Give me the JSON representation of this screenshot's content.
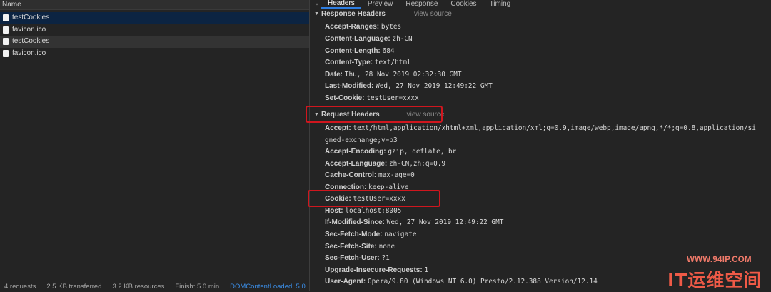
{
  "left_panel": {
    "column_header": "Name",
    "requests": [
      {
        "name": "testCookies"
      },
      {
        "name": "favicon.ico"
      },
      {
        "name": "testCookies"
      },
      {
        "name": "favicon.ico"
      }
    ],
    "status": {
      "requests": "4 requests",
      "transferred": "2.5 KB transferred",
      "resources": "3.2 KB resources",
      "finish": "Finish: 5.0 min",
      "dom_content_loaded": "DOMContentLoaded: 5.0"
    }
  },
  "tabs": {
    "close_glyph": "×",
    "items": [
      {
        "label": "Headers"
      },
      {
        "label": "Preview"
      },
      {
        "label": "Response"
      },
      {
        "label": "Cookies"
      },
      {
        "label": "Timing"
      }
    ]
  },
  "response_headers": {
    "title": "Response Headers",
    "view_source": "view source",
    "items": [
      {
        "key": "Accept-Ranges:",
        "value": "bytes"
      },
      {
        "key": "Content-Language:",
        "value": "zh-CN"
      },
      {
        "key": "Content-Length:",
        "value": "684"
      },
      {
        "key": "Content-Type:",
        "value": "text/html"
      },
      {
        "key": "Date:",
        "value": "Thu, 28 Nov 2019 02:32:30 GMT"
      },
      {
        "key": "Last-Modified:",
        "value": "Wed, 27 Nov 2019 12:49:22 GMT"
      },
      {
        "key": "Set-Cookie:",
        "value": "testUser=xxxx"
      }
    ]
  },
  "request_headers": {
    "title": "Request Headers",
    "view_source": "view source",
    "accept": {
      "key": "Accept:",
      "value": "text/html,application/xhtml+xml,application/xml;q=0.9,image/webp,image/apng,*/*;q=0.8,application/si",
      "continuation": "gned-exchange;v=b3"
    },
    "items": [
      {
        "key": "Accept-Encoding:",
        "value": "gzip, deflate, br"
      },
      {
        "key": "Accept-Language:",
        "value": "zh-CN,zh;q=0.9"
      },
      {
        "key": "Cache-Control:",
        "value": "max-age=0"
      },
      {
        "key": "Connection:",
        "value": "keep-alive"
      },
      {
        "key": "Cookie:",
        "value": "testUser=xxxx"
      },
      {
        "key": "Host:",
        "value": "localhost:8005"
      },
      {
        "key": "If-Modified-Since:",
        "value": "Wed, 27 Nov 2019 12:49:22 GMT"
      },
      {
        "key": "Sec-Fetch-Mode:",
        "value": "navigate"
      },
      {
        "key": "Sec-Fetch-Site:",
        "value": "none"
      },
      {
        "key": "Sec-Fetch-User:",
        "value": "?1"
      },
      {
        "key": "Upgrade-Insecure-Requests:",
        "value": "1"
      },
      {
        "key": "User-Agent:",
        "value": "Opera/9.80 (Windows NT 6.0) Presto/2.12.388 Version/12.14"
      }
    ]
  },
  "watermark": {
    "url": "WWW.94IP.COM",
    "logo": "IT运维空间"
  },
  "colors": {
    "background": "#242424",
    "selected_row": "#0c2442",
    "active_tab_underline": "#2e7de0",
    "highlight_box": "#d0161e",
    "status_link": "#3b8ee8"
  }
}
